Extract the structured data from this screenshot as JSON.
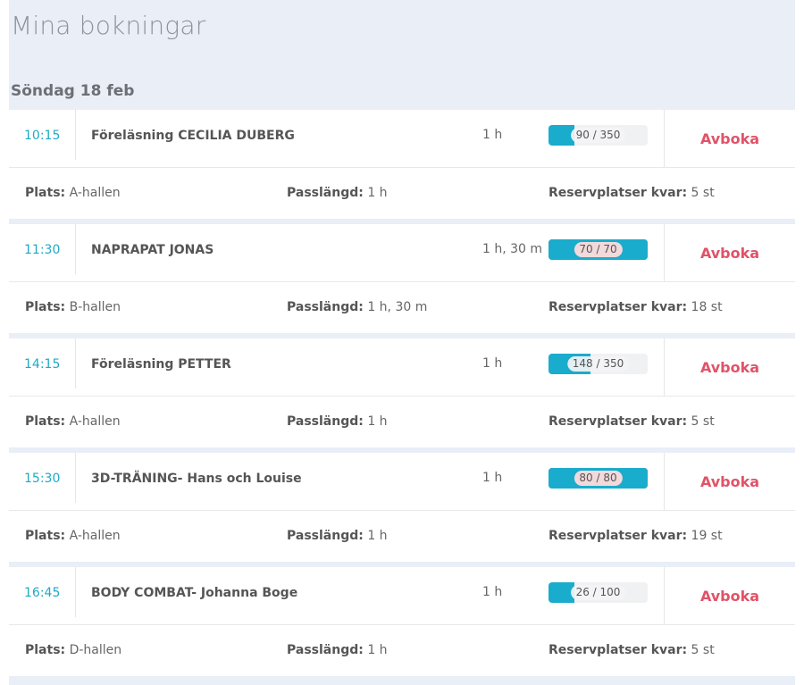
{
  "page": {
    "title": "Mina bokningar"
  },
  "day": {
    "label": "Söndag 18 feb"
  },
  "labels": {
    "location": "Plats:",
    "length": "Passlängd:",
    "reserve": "Reservplatser kvar:",
    "cancel": "Avboka"
  },
  "colors": {
    "time": "#1fa9c6",
    "cancel": "#e05368",
    "capacity_fill": "#1aaccc",
    "capacity_full": "#ea5468"
  },
  "bookings": [
    {
      "time": "10:15",
      "title": "Föreläsning CECILIA DUBERG",
      "duration": "1 h",
      "booked": 90,
      "capacity": 350,
      "capacity_text": "90 / 350",
      "location": "A-hallen",
      "length": "1 h",
      "reserve": "5 st"
    },
    {
      "time": "11:30",
      "title": "NAPRAPAT JONAS",
      "duration": "1 h, 30 m",
      "booked": 70,
      "capacity": 70,
      "capacity_text": "70 / 70",
      "location": "B-hallen",
      "length": "1 h, 30 m",
      "reserve": "18 st"
    },
    {
      "time": "14:15",
      "title": "Föreläsning PETTER",
      "duration": "1 h",
      "booked": 148,
      "capacity": 350,
      "capacity_text": "148 / 350",
      "location": "A-hallen",
      "length": "1 h",
      "reserve": "5 st"
    },
    {
      "time": "15:30",
      "title": "3D-TRÄNING- Hans och Louise",
      "duration": "1 h",
      "booked": 80,
      "capacity": 80,
      "capacity_text": "80 / 80",
      "location": "A-hallen",
      "length": "1 h",
      "reserve": "19 st"
    },
    {
      "time": "16:45",
      "title": "BODY COMBAT- Johanna Boge",
      "duration": "1 h",
      "booked": 26,
      "capacity": 100,
      "capacity_text": "26 / 100",
      "location": "D-hallen",
      "length": "1 h",
      "reserve": "5 st"
    }
  ]
}
